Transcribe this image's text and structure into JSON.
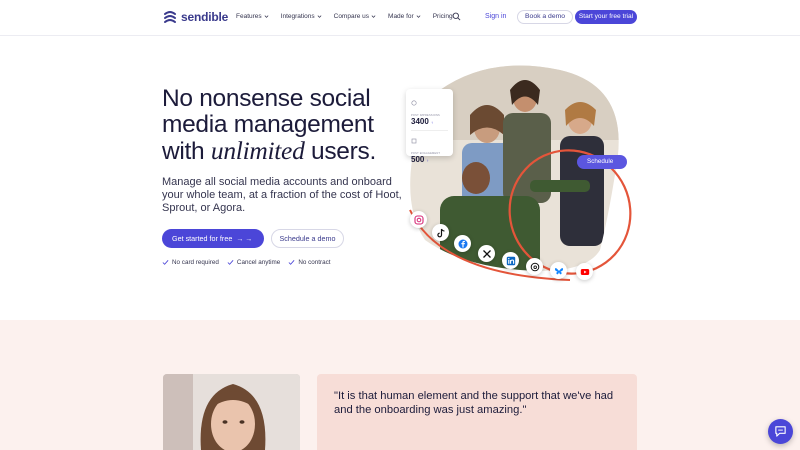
{
  "brand": {
    "name": "sendible",
    "primary_color": "#4b46d8",
    "dark_text_color": "#1c1b3a",
    "band_color": "#fcf1ee"
  },
  "nav": {
    "links": [
      {
        "label": "Features",
        "has_dropdown": true
      },
      {
        "label": "Integrations",
        "has_dropdown": true
      },
      {
        "label": "Compare us",
        "has_dropdown": true
      },
      {
        "label": "Made for",
        "has_dropdown": true
      },
      {
        "label": "Pricing",
        "has_dropdown": false
      }
    ],
    "search_icon": "search-icon",
    "sign_in": "Sign in",
    "book_demo": "Book a demo",
    "free_trial": "Start your free trial"
  },
  "hero": {
    "title_line1": "No nonsense social",
    "title_line2": "media management",
    "title_with": "with",
    "title_emphasis": "unlimited",
    "title_end": "users.",
    "subtitle": "Manage all social media accounts and onboard your whole team, at a fraction of the cost of Hoot, Sprout, or Agora.",
    "cta_primary": "Get started for free",
    "cta_arrow": "→  →",
    "cta_secondary": "Schedule a demo",
    "checks": [
      "No card required",
      "Cancel anytime",
      "No contract"
    ]
  },
  "hero_card": {
    "stat1_label": "POST IMPRESSIONS",
    "stat1_value": "3400",
    "stat2_label": "POST ENGAGEMENT",
    "stat2_value": "500",
    "trend": "↑"
  },
  "schedule_pill": "Schedule",
  "social_icons": [
    "instagram-icon",
    "tiktok-icon",
    "facebook-icon",
    "x-icon",
    "linkedin-icon",
    "threads-icon",
    "bluesky-icon",
    "youtube-icon"
  ],
  "testimonial": {
    "quote": "\"It is that human element and the support that we've had and the onboarding was just amazing.\""
  },
  "chat": {
    "icon": "chat-icon"
  }
}
